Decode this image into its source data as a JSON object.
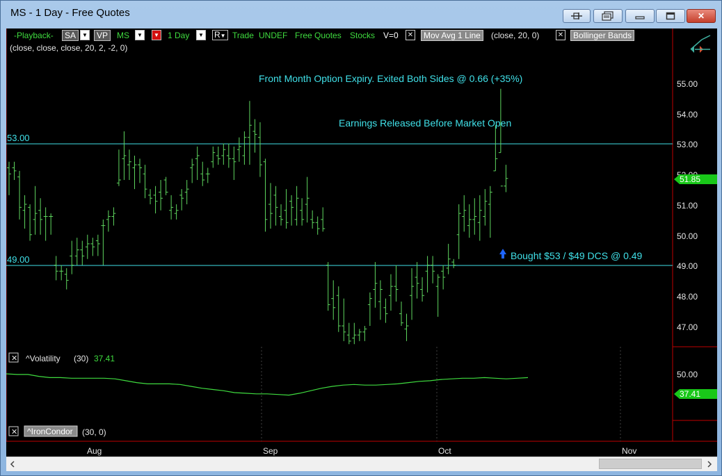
{
  "window": {
    "title": "MS - 1 Day - Free Quotes",
    "close_glyph": "✕"
  },
  "toolbar": {
    "playback": "-Playback-",
    "sa": "SA",
    "vp": "VP",
    "symbol": "MS",
    "interval": "1 Day",
    "r": "R",
    "trade": "Trade",
    "undef": "UNDEF",
    "feed": "Free Quotes",
    "stocks": "Stocks",
    "v": "V=0",
    "mov_avg": "Mov Avg 1 Line",
    "mov_avg_params": "(close,  20,  0)",
    "bollinger": "Bollinger Bands",
    "bollinger_params": "(close,  close,  close,  20,  2,  -2,  0)",
    "x_glyph": "✕",
    "dropdown_glyph": "▼"
  },
  "price_pane": {
    "axis_labels": [
      "55.00",
      "54.00",
      "53.00",
      "52.00",
      "51.00",
      "50.00",
      "49.00",
      "48.00",
      "47.00"
    ],
    "current_price": "51.85",
    "hline_upper": "53.00",
    "hline_lower": "49.00",
    "annotation_expiry": "Front Month Option Expiry. Exited Both Sides @ 0.66 (+35%)",
    "annotation_earnings": "Earnings Released Before Market Open",
    "annotation_bought": "Bought $53 / $49 DCS @ 0.49"
  },
  "volatility_pane": {
    "name": "^Volatility",
    "period": "(30)",
    "value": "37.41",
    "axis_label": "50.00",
    "current_value": "37.41"
  },
  "ironcondor_pane": {
    "name": "^IronCondor",
    "params": "(30,  0)"
  },
  "time_axis": {
    "labels": [
      "Aug",
      "Sep",
      "Oct",
      "Nov"
    ]
  },
  "colors": {
    "bar": "#5fd75f",
    "line": "#40e0e8",
    "toolbar_green": "#3fdc3f",
    "separator": "#c00000",
    "price_tag": "#19c819"
  },
  "chart_data": {
    "type": "ohlc",
    "ylim": [
      46.0,
      55.5
    ],
    "bars": [
      {
        "o": 52.2,
        "h": 52.4,
        "l": 51.3,
        "c": 52.0
      },
      {
        "o": 52.2,
        "h": 52.4,
        "l": 51.8,
        "c": 52.1
      },
      {
        "o": 51.9,
        "h": 52.1,
        "l": 50.5,
        "c": 50.9
      },
      {
        "o": 50.8,
        "h": 51.3,
        "l": 50.2,
        "c": 51.0
      },
      {
        "o": 50.9,
        "h": 51.0,
        "l": 49.8,
        "c": 50.0
      },
      {
        "o": 50.5,
        "h": 51.6,
        "l": 50.0,
        "c": 50.7
      },
      {
        "o": 50.8,
        "h": 51.2,
        "l": 50.0,
        "c": 50.5
      },
      {
        "o": 50.6,
        "h": 50.9,
        "l": 49.8,
        "c": 50.6
      },
      {
        "o": 50.6,
        "h": 50.7,
        "l": 50.0,
        "c": 50.6
      },
      {
        "o": 49.0,
        "h": 49.3,
        "l": 48.5,
        "c": 48.8
      },
      {
        "o": 48.8,
        "h": 49.0,
        "l": 48.5,
        "c": 48.8
      },
      {
        "o": 48.7,
        "h": 48.9,
        "l": 48.2,
        "c": 48.5
      },
      {
        "o": 49.3,
        "h": 49.8,
        "l": 48.7,
        "c": 49.0
      },
      {
        "o": 49.3,
        "h": 49.9,
        "l": 49.0,
        "c": 49.5
      },
      {
        "o": 49.5,
        "h": 49.8,
        "l": 49.0,
        "c": 49.3
      },
      {
        "o": 49.6,
        "h": 50.0,
        "l": 49.2,
        "c": 49.7
      },
      {
        "o": 49.7,
        "h": 49.9,
        "l": 49.3,
        "c": 49.6
      },
      {
        "o": 49.8,
        "h": 50.0,
        "l": 49.3,
        "c": 49.7
      },
      {
        "o": 50.3,
        "h": 50.5,
        "l": 49.0,
        "c": 50.3
      },
      {
        "o": 50.5,
        "h": 50.8,
        "l": 50.1,
        "c": 50.6
      },
      {
        "o": 50.6,
        "h": 50.9,
        "l": 50.3,
        "c": 50.7
      },
      {
        "o": 51.7,
        "h": 52.8,
        "l": 51.6,
        "c": 51.8
      },
      {
        "o": 52.5,
        "h": 53.4,
        "l": 51.8,
        "c": 52.6
      },
      {
        "o": 52.3,
        "h": 52.8,
        "l": 51.8,
        "c": 52.4
      },
      {
        "o": 52.2,
        "h": 52.6,
        "l": 51.5,
        "c": 52.3
      },
      {
        "o": 52.3,
        "h": 52.5,
        "l": 51.7,
        "c": 52.2
      },
      {
        "o": 52.0,
        "h": 52.3,
        "l": 51.2,
        "c": 51.5
      },
      {
        "o": 51.3,
        "h": 51.5,
        "l": 51.0,
        "c": 51.2
      },
      {
        "o": 51.3,
        "h": 51.6,
        "l": 50.7,
        "c": 51.1
      },
      {
        "o": 51.4,
        "h": 51.8,
        "l": 50.8,
        "c": 51.2
      },
      {
        "o": 51.8,
        "h": 51.9,
        "l": 51.3,
        "c": 51.4
      },
      {
        "o": 50.8,
        "h": 51.3,
        "l": 50.5,
        "c": 50.9
      },
      {
        "o": 50.7,
        "h": 51.0,
        "l": 50.5,
        "c": 50.8
      },
      {
        "o": 51.3,
        "h": 51.5,
        "l": 50.8,
        "c": 51.2
      },
      {
        "o": 51.4,
        "h": 51.8,
        "l": 51.0,
        "c": 51.5
      },
      {
        "o": 52.2,
        "h": 52.5,
        "l": 51.7,
        "c": 52.3
      },
      {
        "o": 52.5,
        "h": 52.9,
        "l": 51.8,
        "c": 52.6
      },
      {
        "o": 52.0,
        "h": 52.4,
        "l": 51.6,
        "c": 51.8
      },
      {
        "o": 52.0,
        "h": 52.2,
        "l": 51.7,
        "c": 52.0
      },
      {
        "o": 52.4,
        "h": 52.9,
        "l": 52.2,
        "c": 52.7
      },
      {
        "o": 52.6,
        "h": 52.9,
        "l": 52.3,
        "c": 52.5
      },
      {
        "o": 52.6,
        "h": 53.0,
        "l": 52.3,
        "c": 52.8
      },
      {
        "o": 52.6,
        "h": 53.0,
        "l": 52.2,
        "c": 52.5
      },
      {
        "o": 52.5,
        "h": 52.9,
        "l": 51.8,
        "c": 52.4
      },
      {
        "o": 52.8,
        "h": 53.2,
        "l": 52.4,
        "c": 52.9
      },
      {
        "o": 52.6,
        "h": 53.4,
        "l": 52.3,
        "c": 53.2
      },
      {
        "o": 53.2,
        "h": 54.4,
        "l": 52.3,
        "c": 53.6
      },
      {
        "o": 53.4,
        "h": 53.8,
        "l": 52.7,
        "c": 53.3
      },
      {
        "o": 53.2,
        "h": 53.7,
        "l": 51.9,
        "c": 52.3
      },
      {
        "o": 52.4,
        "h": 52.5,
        "l": 50.1,
        "c": 50.5
      },
      {
        "o": 51.0,
        "h": 51.7,
        "l": 50.2,
        "c": 50.7
      },
      {
        "o": 51.3,
        "h": 51.6,
        "l": 50.3,
        "c": 50.9
      },
      {
        "o": 50.6,
        "h": 51.0,
        "l": 50.3,
        "c": 50.5
      },
      {
        "o": 50.8,
        "h": 51.5,
        "l": 50.2,
        "c": 50.4
      },
      {
        "o": 51.1,
        "h": 51.3,
        "l": 50.3,
        "c": 50.9
      },
      {
        "o": 50.5,
        "h": 51.6,
        "l": 50.3,
        "c": 51.2
      },
      {
        "o": 50.8,
        "h": 51.2,
        "l": 50.3,
        "c": 50.5
      },
      {
        "o": 51.0,
        "h": 51.9,
        "l": 50.4,
        "c": 51.2
      },
      {
        "o": 50.5,
        "h": 50.8,
        "l": 50.2,
        "c": 50.4
      },
      {
        "o": 50.4,
        "h": 50.6,
        "l": 50.0,
        "c": 50.2
      },
      {
        "o": 50.5,
        "h": 50.9,
        "l": 50.1,
        "c": 50.2
      },
      {
        "o": 49.0,
        "h": 49.1,
        "l": 47.5,
        "c": 47.7
      },
      {
        "o": 47.9,
        "h": 48.5,
        "l": 47.2,
        "c": 47.6
      },
      {
        "o": 48.0,
        "h": 48.3,
        "l": 46.8,
        "c": 47.0
      },
      {
        "o": 47.0,
        "h": 47.9,
        "l": 46.5,
        "c": 46.8
      },
      {
        "o": 46.7,
        "h": 47.1,
        "l": 46.4,
        "c": 46.5
      },
      {
        "o": 46.6,
        "h": 47.1,
        "l": 46.4,
        "c": 46.7
      },
      {
        "o": 46.7,
        "h": 46.9,
        "l": 46.5,
        "c": 46.8
      },
      {
        "o": 46.8,
        "h": 47.0,
        "l": 46.5,
        "c": 46.9
      },
      {
        "o": 47.7,
        "h": 48.1,
        "l": 47.0,
        "c": 47.9
      },
      {
        "o": 48.2,
        "h": 49.1,
        "l": 47.6,
        "c": 48.4
      },
      {
        "o": 47.8,
        "h": 48.5,
        "l": 47.2,
        "c": 48.2
      },
      {
        "o": 47.6,
        "h": 47.9,
        "l": 47.1,
        "c": 47.4
      },
      {
        "o": 48.0,
        "h": 48.7,
        "l": 47.5,
        "c": 48.3
      },
      {
        "o": 48.3,
        "h": 49.0,
        "l": 47.8,
        "c": 48.2
      },
      {
        "o": 47.4,
        "h": 47.8,
        "l": 47.0,
        "c": 47.1
      },
      {
        "o": 46.9,
        "h": 47.4,
        "l": 46.5,
        "c": 47.0
      },
      {
        "o": 48.0,
        "h": 48.9,
        "l": 47.2,
        "c": 48.3
      },
      {
        "o": 48.6,
        "h": 49.1,
        "l": 47.9,
        "c": 48.4
      },
      {
        "o": 48.2,
        "h": 48.6,
        "l": 47.8,
        "c": 48.0
      },
      {
        "o": 48.8,
        "h": 49.3,
        "l": 48.1,
        "c": 49.0
      },
      {
        "o": 49.0,
        "h": 49.3,
        "l": 48.4,
        "c": 48.8
      },
      {
        "o": 48.3,
        "h": 48.7,
        "l": 47.3,
        "c": 48.6
      },
      {
        "o": 48.8,
        "h": 49.0,
        "l": 48.2,
        "c": 48.6
      },
      {
        "o": 48.9,
        "h": 49.7,
        "l": 48.7,
        "c": 49.2
      },
      {
        "o": 49.1,
        "h": 49.2,
        "l": 48.9,
        "c": 49.0
      },
      {
        "o": 50.0,
        "h": 51.0,
        "l": 49.2,
        "c": 50.7
      },
      {
        "o": 50.6,
        "h": 51.3,
        "l": 50.1,
        "c": 50.8
      },
      {
        "o": 50.3,
        "h": 51.0,
        "l": 49.9,
        "c": 50.5
      },
      {
        "o": 50.5,
        "h": 51.2,
        "l": 50.0,
        "c": 50.6
      },
      {
        "o": 50.4,
        "h": 51.3,
        "l": 49.8,
        "c": 50.8
      },
      {
        "o": 50.6,
        "h": 51.5,
        "l": 50.3,
        "c": 51.1
      },
      {
        "o": 51.0,
        "h": 51.6,
        "l": 49.9,
        "c": 51.4
      },
      {
        "o": 52.1,
        "h": 53.6,
        "l": 52.1,
        "c": 52.5
      },
      {
        "o": 52.7,
        "h": 54.8,
        "l": 52.7,
        "c": 51.6
      },
      {
        "o": 51.6,
        "h": 52.3,
        "l": 51.4,
        "c": 51.85
      }
    ],
    "horizontal_lines": [
      53.0,
      49.0
    ],
    "volatility": [
      50.0,
      49.9,
      49.9,
      49.6,
      49.4,
      49.4,
      49.3,
      49.3,
      49.3,
      49.3,
      49.2,
      48.9,
      48.6,
      48.4,
      48.4,
      48.4,
      48.3,
      48.0,
      47.7,
      47.5,
      47.3,
      47.0,
      46.9,
      46.8,
      46.8,
      46.7,
      46.6,
      46.9,
      47.3,
      47.7,
      48.0,
      48.2,
      48.3,
      48.2,
      48.2,
      48.3,
      48.4,
      48.6,
      48.8,
      48.9,
      49.1,
      49.2,
      49.3,
      49.3,
      49.4,
      49.3,
      49.2,
      49.3,
      49.4
    ]
  }
}
